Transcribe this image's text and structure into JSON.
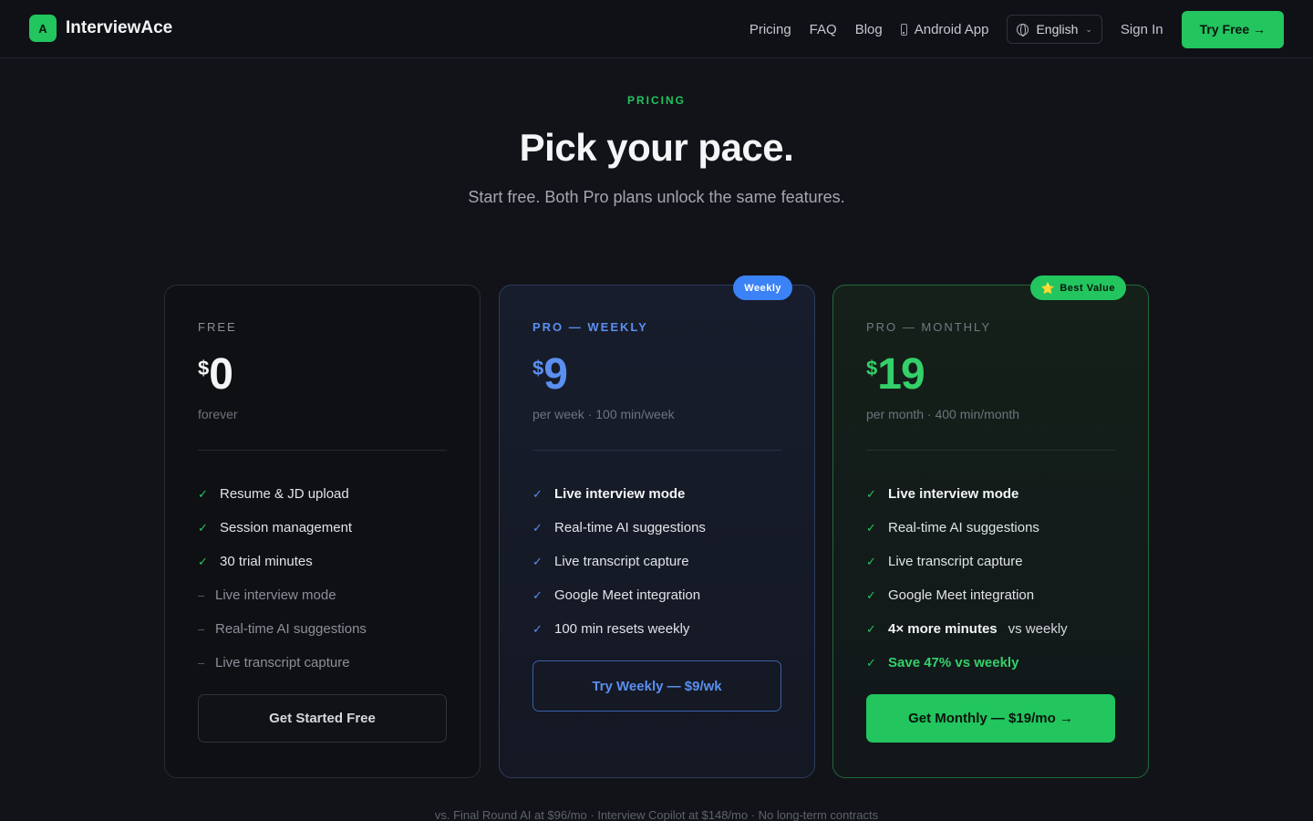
{
  "nav": {
    "logo_letter": "A",
    "brand": "InterviewAce",
    "links": [
      "Pricing",
      "FAQ",
      "Blog"
    ],
    "android": "Android App",
    "language": "English",
    "sign_in": "Sign In",
    "try_free": "Try Free →"
  },
  "hero": {
    "eyebrow": "PRICING",
    "title": "Pick your pace.",
    "subtitle": "Start free. Both Pro plans unlock the same features."
  },
  "plans": {
    "free": {
      "name": "FREE",
      "currency": "$",
      "amount": "0",
      "period": "forever",
      "features": [
        {
          "text": "Resume & JD upload",
          "mark": "✓"
        },
        {
          "text": "Session management",
          "mark": "✓"
        },
        {
          "text": "30 trial minutes",
          "mark": "✓"
        },
        {
          "text": "Live interview mode",
          "mark": "–"
        },
        {
          "text": "Real-time AI suggestions",
          "mark": "–"
        },
        {
          "text": "Live transcript capture",
          "mark": "–"
        }
      ],
      "cta": "Get Started Free"
    },
    "weekly": {
      "badge": "Weekly",
      "name": "PRO — WEEKLY",
      "currency": "$",
      "amount": "9",
      "period": "per week · 100 min/week",
      "features": [
        {
          "text": "Live interview mode",
          "mark": "✓"
        },
        {
          "text": "Real-time AI suggestions",
          "mark": "✓"
        },
        {
          "text": "Live transcript capture",
          "mark": "✓"
        },
        {
          "text": "Google Meet integration",
          "mark": "✓"
        },
        {
          "text": "100 min resets weekly",
          "mark": "✓"
        }
      ],
      "cta": "Try Weekly — $9/wk"
    },
    "monthly": {
      "badge": "Best Value",
      "badge_icon": "⭐",
      "name": "PRO — MONTHLY",
      "currency": "$",
      "amount": "19",
      "period": "per month · 400 min/month",
      "features": [
        {
          "text": "Live interview mode",
          "mark": "✓"
        },
        {
          "text": "Real-time AI suggestions",
          "mark": "✓"
        },
        {
          "text": "Live transcript capture",
          "mark": "✓"
        },
        {
          "text": "Google Meet integration",
          "mark": "✓"
        },
        {
          "text": "4× more minutes",
          "suffix": "vs weekly",
          "mark": "✓"
        },
        {
          "text": "Save 47% vs weekly",
          "mark": "✓"
        }
      ],
      "cta": "Get Monthly — $19/mo →"
    }
  },
  "footnote": "vs. Final Round AI at $96/mo · Interview Copilot at $148/mo · No long-term contracts",
  "colors": {
    "accent_green": "#22c55e",
    "accent_blue": "#3b82f6",
    "background": "#121319"
  }
}
